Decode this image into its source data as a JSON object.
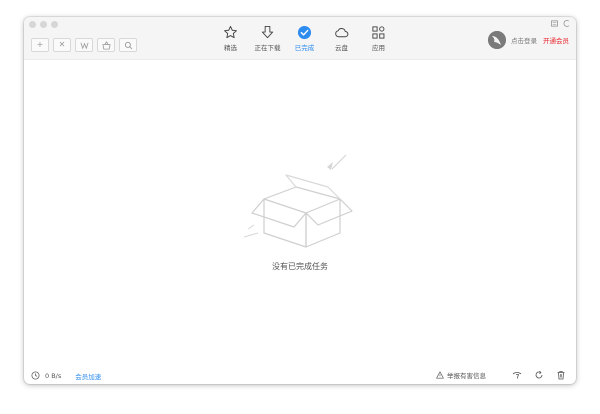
{
  "nav": {
    "items": [
      {
        "id": "featured",
        "label": "精选",
        "icon": "star-icon"
      },
      {
        "id": "downloading",
        "label": "正在下载",
        "icon": "download-arrow-icon"
      },
      {
        "id": "completed",
        "label": "已完成",
        "icon": "check-circle-icon",
        "active": true
      },
      {
        "id": "cloud",
        "label": "云盘",
        "icon": "cloud-icon"
      },
      {
        "id": "apps",
        "label": "应用",
        "icon": "apps-icon"
      }
    ]
  },
  "toolbar": {
    "new_task_symbol": "+",
    "delete_symbol": "✕"
  },
  "user": {
    "login_label": "点击登录",
    "vip_label": "开通会员"
  },
  "main": {
    "empty_message": "没有已完成任务"
  },
  "status": {
    "speed": "0 B/s",
    "accelerate_label": "会员加速",
    "report_label": "举报有害信息"
  },
  "colors": {
    "accent": "#2d8cf0",
    "vip": "#e8252b"
  }
}
